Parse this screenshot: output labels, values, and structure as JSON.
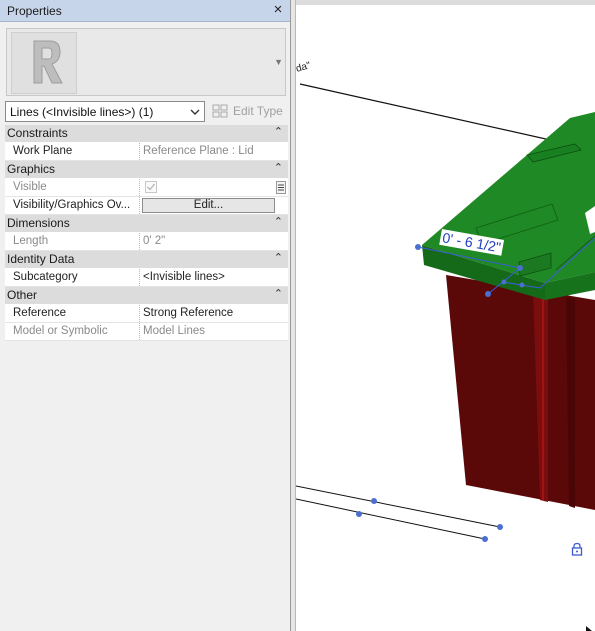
{
  "panel": {
    "title": "Properties",
    "type_selector": "Lines (<Invisible lines>) (1)",
    "edit_type_label": "Edit Type",
    "sections": {
      "constraints": "Constraints",
      "graphics": "Graphics",
      "dimensions": "Dimensions",
      "identity": "Identity Data",
      "other": "Other"
    },
    "rows": {
      "work_plane": {
        "label": "Work Plane",
        "value": "Reference Plane : Lid"
      },
      "visible": {
        "label": "Visible",
        "checked": true
      },
      "vg_overrides": {
        "label": "Visibility/Graphics Ov...",
        "button": "Edit..."
      },
      "length": {
        "label": "Length",
        "value": "0'  2\""
      },
      "subcategory": {
        "label": "Subcategory",
        "value": "<Invisible lines>"
      },
      "reference": {
        "label": "Reference",
        "value": "Strong Reference"
      },
      "model_or_symbolic": {
        "label": "Model or Symbolic",
        "value": "Model Lines"
      }
    }
  },
  "viewport": {
    "dimension_label": "0' - 6 1/2\"",
    "label_fragment": "da\"",
    "colors": {
      "lid": "#1f8a25",
      "lid_dark": "#156a1a",
      "body": "#5a0808",
      "body_light": "#7a0d0d",
      "dim_blue": "#1f3fbf"
    }
  }
}
